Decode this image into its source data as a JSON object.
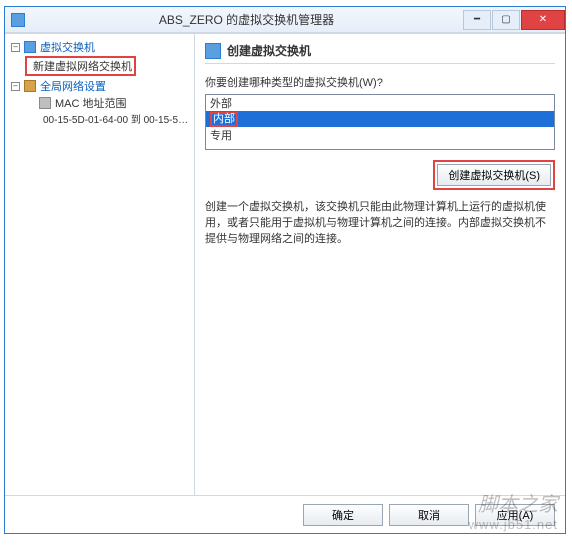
{
  "window": {
    "title": "ABS_ZERO 的虚拟交换机管理器"
  },
  "tree": {
    "root1": "虚拟交换机",
    "new_switch": "新建虚拟网络交换机",
    "root2": "全局网络设置",
    "mac_title": "MAC 地址范围",
    "mac_range": "00-15-5D-01-64-00 到 00-15-5D-0..."
  },
  "right": {
    "header": "创建虚拟交换机",
    "question": "你要创建哪种类型的虚拟交换机(W)?",
    "options": {
      "o0": "外部",
      "o1": "内部",
      "o2": "专用"
    },
    "create_btn": "创建虚拟交换机(S)",
    "description": "创建一个虚拟交换机，该交换机只能由此物理计算机上运行的虚拟机使用，或者只能用于虚拟机与物理计算机之间的连接。内部虚拟交换机不提供与物理网络之间的连接。"
  },
  "footer": {
    "ok": "确定",
    "cancel": "取消",
    "apply": "应用(A)"
  },
  "watermark": {
    "t1": "脚本之家",
    "t2": "www.jb51.net"
  }
}
